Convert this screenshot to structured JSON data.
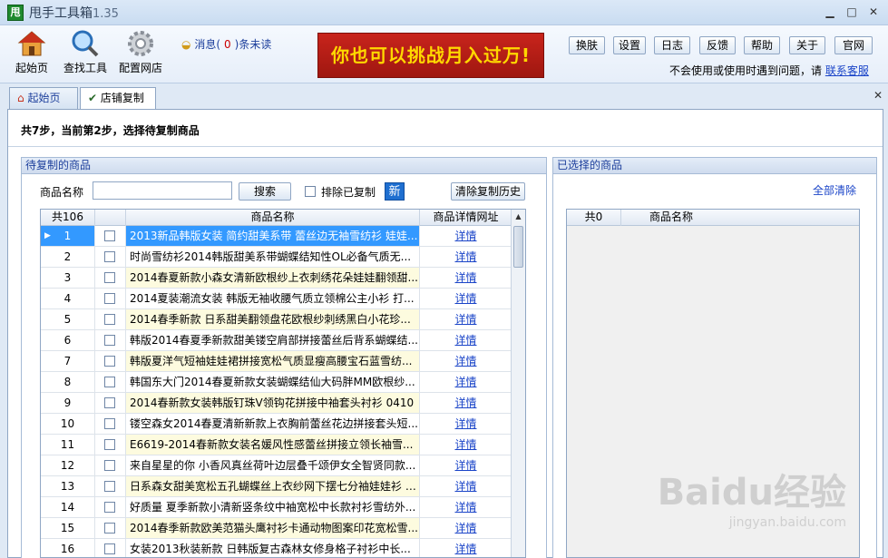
{
  "window": {
    "icon_text": "甩",
    "title": "甩手工具箱",
    "version": "1.35"
  },
  "toolbar": {
    "home_label": "起始页",
    "find_label": "查找工具",
    "config_label": "配置网店",
    "msg_prefix": "消息(",
    "msg_count": "0",
    "msg_suffix": ")条未读",
    "banner_text": "你也可以挑战月入过万!",
    "buttons": [
      "换肤",
      "设置",
      "日志",
      "反馈",
      "帮助",
      "关于",
      "官网"
    ],
    "help_text": "不会使用或使用时遇到问题，请",
    "help_link": "联系客服"
  },
  "tabs": [
    {
      "label": "起始页"
    },
    {
      "label": "店铺复制"
    }
  ],
  "main": {
    "step_text": "共7步，当前第2步，选择待复制商品",
    "left_panel": {
      "title": "待复制的商品",
      "name_label": "商品名称",
      "name_value": "",
      "search_button": "搜索",
      "exclude_label": "排除已复制",
      "new_badge": "新",
      "clear_history_button": "清除复制历史",
      "columns": {
        "count": "共106",
        "name": "商品名称",
        "url": "商品详情网址"
      },
      "rows": [
        {
          "num": "1",
          "name": "2013新品韩版女装 简约甜美系带 蕾丝边无袖雪纺衫 娃娃...",
          "link": "详情"
        },
        {
          "num": "2",
          "name": "时尚雪纺衫2014韩版甜美系带蝴蝶结知性OL必备气质无...",
          "link": "详情"
        },
        {
          "num": "3",
          "name": "2014春夏新款小森女清新欧根纱上衣刺绣花朵娃娃翻领甜...",
          "link": "详情"
        },
        {
          "num": "4",
          "name": "2014夏装潮流女装 韩版无袖收腰气质立领棉公主小衫 打...",
          "link": "详情"
        },
        {
          "num": "5",
          "name": "2014春季新款 日系甜美翻领盘花欧根纱刺绣黑白小花珍...",
          "link": "详情"
        },
        {
          "num": "6",
          "name": "韩版2014春夏季新款甜美镂空肩部拼接蕾丝后背系蝴蝶结...",
          "link": "详情"
        },
        {
          "num": "7",
          "name": "韩版夏洋气短袖娃娃裙拼接宽松气质显瘦高腰宝石蓝雪纺...",
          "link": "详情"
        },
        {
          "num": "8",
          "name": "韩国东大门2014春夏新款女装蝴蝶结仙大码胖MM欧根纱...",
          "link": "详情"
        },
        {
          "num": "9",
          "name": "2014春新款女装韩版钉珠V领钩花拼接中袖套头衬衫 0410",
          "link": "详情"
        },
        {
          "num": "10",
          "name": "镂空森女2014春夏清新新款上衣胸前蕾丝花边拼接套头短...",
          "link": "详情"
        },
        {
          "num": "11",
          "name": "E6619-2014春新款女装名媛风性感蕾丝拼接立领长袖雪...",
          "link": "详情"
        },
        {
          "num": "12",
          "name": "来自星星的你 小香风真丝荷叶边层叠千颂伊女全智贤同款...",
          "link": "详情"
        },
        {
          "num": "13",
          "name": "日系森女甜美宽松五孔蝴蝶丝上衣纱网下摆七分袖娃娃衫 上...",
          "link": "详情"
        },
        {
          "num": "14",
          "name": "好质量 夏季新款小清新竖条纹中袖宽松中长款衬衫雪纺外...",
          "link": "详情"
        },
        {
          "num": "15",
          "name": "2014春季新款欧美范猫头鹰衬衫卡通动物图案印花宽松雪...",
          "link": "详情"
        },
        {
          "num": "16",
          "name": "女装2013秋装新款 日韩版复古森林女修身格子衬衫中长...",
          "link": "详情"
        }
      ]
    },
    "right_panel": {
      "title": "已选择的商品",
      "clear_all": "全部清除",
      "columns": {
        "count": "共0",
        "name": "商品名称"
      }
    },
    "watermark": "Baidu经验",
    "watermark_sub": "jingyan.baidu.com"
  }
}
